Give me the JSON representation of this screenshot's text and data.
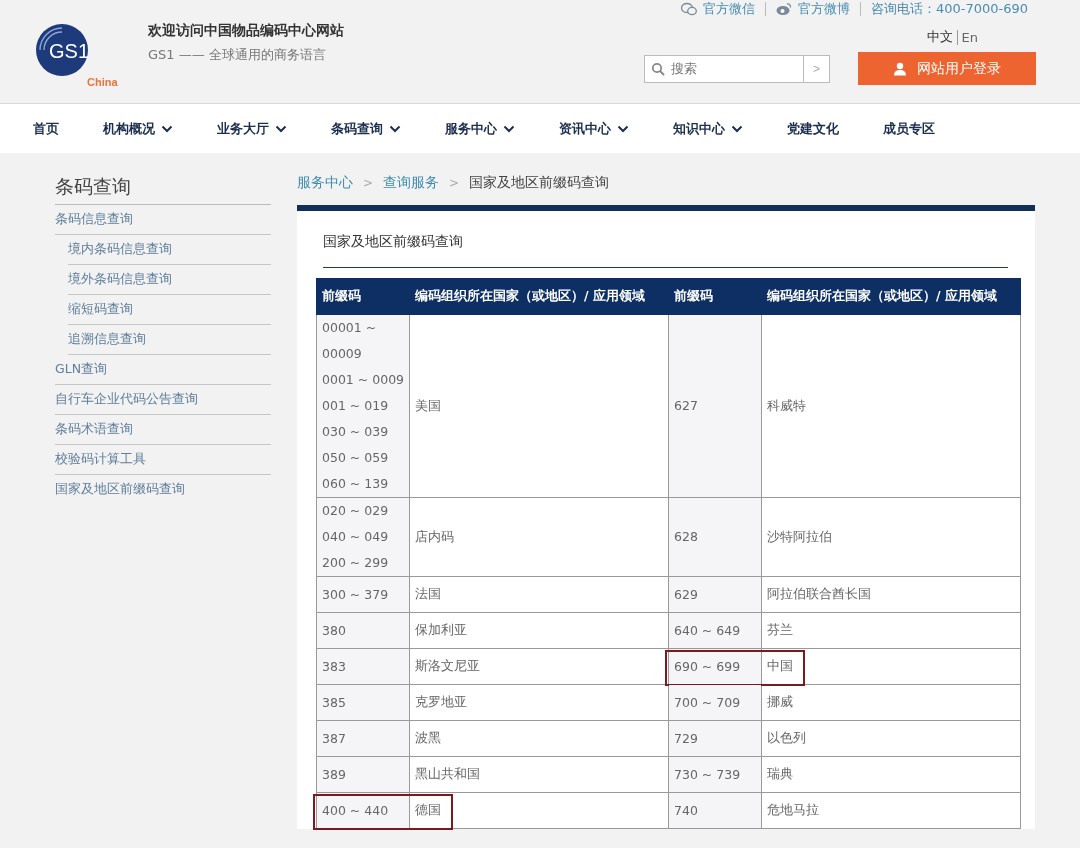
{
  "top_links": [
    {
      "kind": "wechat",
      "label": "官方微信"
    },
    {
      "kind": "weibo",
      "label": "官方微博"
    },
    {
      "kind": "phone",
      "label": "咨询电话：400-7000-690"
    }
  ],
  "logo": {
    "mark": "GS1",
    "region": "China"
  },
  "site": {
    "title": "欢迎访问中国物品编码中心网站",
    "tagline": "GS1 —— 全球通用的商务语言"
  },
  "languages": [
    {
      "label": "中文",
      "selected": true
    },
    {
      "label": "En",
      "selected": false
    }
  ],
  "search": {
    "placeholder": "搜索",
    "submit": ">"
  },
  "login_button": "网站用户登录",
  "nav": [
    {
      "label": "首页",
      "dropdown": false
    },
    {
      "label": "机构概况",
      "dropdown": true
    },
    {
      "label": "业务大厅",
      "dropdown": true
    },
    {
      "label": "条码查询",
      "dropdown": true
    },
    {
      "label": "服务中心",
      "dropdown": true
    },
    {
      "label": "资讯中心",
      "dropdown": true
    },
    {
      "label": "知识中心",
      "dropdown": true
    },
    {
      "label": "党建文化",
      "dropdown": false
    },
    {
      "label": "成员专区",
      "dropdown": false
    }
  ],
  "sidebar": {
    "title": "条码查询",
    "items": [
      {
        "label": "条码信息查询",
        "children": [
          {
            "label": "境内条码信息查询"
          },
          {
            "label": "境外条码信息查询"
          },
          {
            "label": "缩短码查询"
          },
          {
            "label": "追溯信息查询"
          }
        ]
      },
      {
        "label": "GLN查询"
      },
      {
        "label": "自行车企业代码公告查询"
      },
      {
        "label": "条码术语查询"
      },
      {
        "label": "校验码计算工具"
      },
      {
        "label": "国家及地区前缀码查询"
      }
    ]
  },
  "breadcrumb": [
    {
      "label": "服务中心"
    },
    {
      "separator": ">",
      "label": "查询服务"
    },
    {
      "separator": ">",
      "label": "国家及地区前缀码查询"
    }
  ],
  "panel_title": "国家及地区前缀码查询",
  "table": {
    "columns": [
      "前缀码",
      "编码组织所在国家（或地区）/ 应用领域",
      "前缀码",
      "编码组织所在国家（或地区）/ 应用领域"
    ],
    "rows": [
      {
        "left": {
          "prefixes": [
            "00001 ~",
            "00009",
            "0001 ~ 0009",
            "001 ~ 019",
            "030 ~ 039",
            "050 ~ 059",
            "060 ~ 139"
          ],
          "region": "美国",
          "highlighted": false
        },
        "right": {
          "prefixes": [
            "627"
          ],
          "region": "科威特",
          "highlighted": false
        }
      },
      {
        "left": {
          "prefixes": [
            "020 ~ 029",
            "040 ~ 049",
            "200 ~ 299"
          ],
          "region": "店内码",
          "highlighted": false
        },
        "right": {
          "prefixes": [
            "628"
          ],
          "region": "沙特阿拉伯",
          "highlighted": false
        }
      },
      {
        "left": {
          "prefixes": [
            "300 ~ 379"
          ],
          "region": "法国",
          "highlighted": false
        },
        "right": {
          "prefixes": [
            "629"
          ],
          "region": "阿拉伯联合酋长国",
          "highlighted": false
        }
      },
      {
        "left": {
          "prefixes": [
            "380"
          ],
          "region": "保加利亚",
          "highlighted": false
        },
        "right": {
          "prefixes": [
            "640 ~ 649"
          ],
          "region": "芬兰",
          "highlighted": false
        }
      },
      {
        "left": {
          "prefixes": [
            "383"
          ],
          "region": "斯洛文尼亚",
          "highlighted": false
        },
        "right": {
          "prefixes": [
            "690 ~ 699"
          ],
          "region": "中国",
          "highlighted": true
        }
      },
      {
        "left": {
          "prefixes": [
            "385"
          ],
          "region": "克罗地亚",
          "highlighted": false
        },
        "right": {
          "prefixes": [
            "700 ~ 709"
          ],
          "region": "挪威",
          "highlighted": false
        }
      },
      {
        "left": {
          "prefixes": [
            "387"
          ],
          "region": "波黑",
          "highlighted": false
        },
        "right": {
          "prefixes": [
            "729"
          ],
          "region": "以色列",
          "highlighted": false
        }
      },
      {
        "left": {
          "prefixes": [
            "389"
          ],
          "region": "黑山共和国",
          "highlighted": false
        },
        "right": {
          "prefixes": [
            "730 ~ 739"
          ],
          "region": "瑞典",
          "highlighted": false
        }
      },
      {
        "left": {
          "prefixes": [
            "400 ~ 440"
          ],
          "region": "德国",
          "highlighted": true
        },
        "right": {
          "prefixes": [
            "740"
          ],
          "region": "危地马拉",
          "highlighted": false
        }
      }
    ]
  }
}
